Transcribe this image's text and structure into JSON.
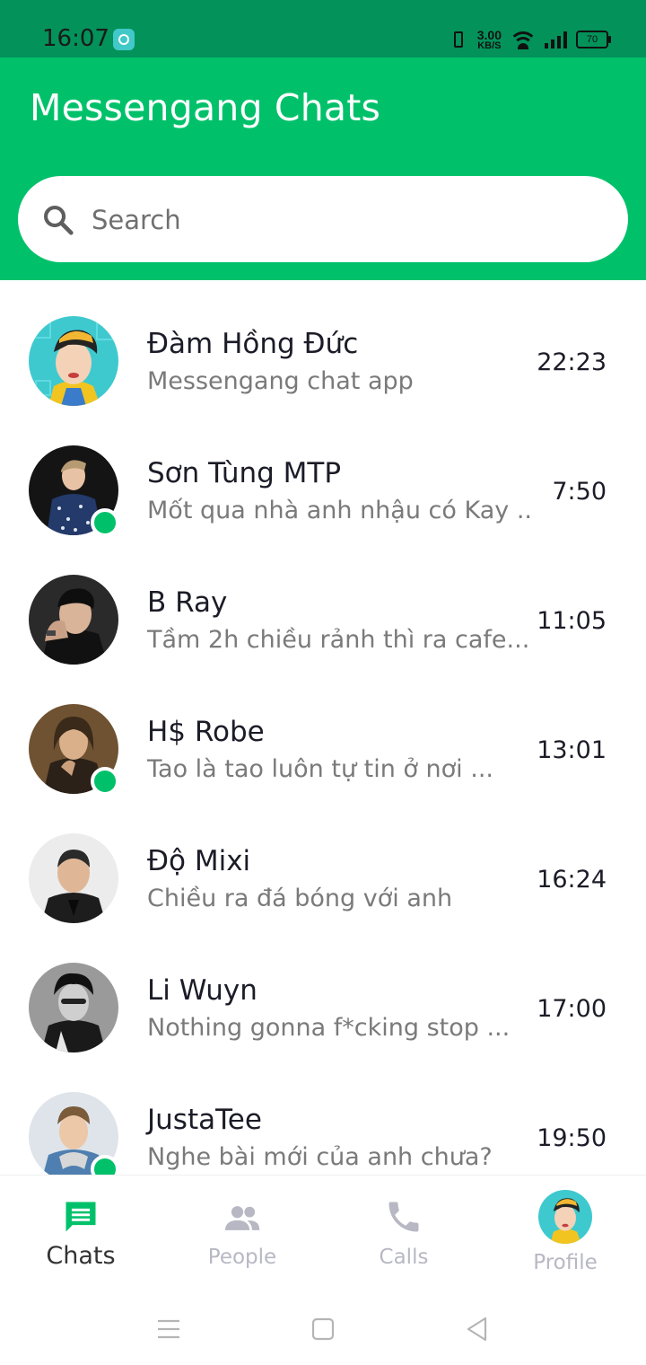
{
  "status_bar": {
    "time": "16:07",
    "net_speed": "3.00",
    "net_unit": "KB/S",
    "battery": "70"
  },
  "header": {
    "title": "Messengang Chats"
  },
  "search": {
    "placeholder": "Search"
  },
  "chats": [
    {
      "name": "Đàm Hồng Đức",
      "message": "Messengang chat app",
      "time": "22:23",
      "online": false,
      "avatar": "illustrated-avatar"
    },
    {
      "name": "Sơn Tùng MTP",
      "message": "Mốt qua nhà anh nhậu có Kay ...",
      "time": "7:50",
      "online": true,
      "avatar": "photo-avatar"
    },
    {
      "name": "B Ray",
      "message": "Tầm 2h chiều rảnh thì ra cafe...",
      "time": "11:05",
      "online": false,
      "avatar": "photo-avatar"
    },
    {
      "name": "H$ Robe",
      "message": "Tao là tao luôn tự tin ở nơi ...",
      "time": "13:01",
      "online": true,
      "avatar": "photo-avatar"
    },
    {
      "name": "Độ Mixi",
      "message": "Chiều ra đá bóng với anh",
      "time": "16:24",
      "online": false,
      "avatar": "photo-avatar"
    },
    {
      "name": "Li Wuyn",
      "message": "Nothing gonna f*cking stop ...",
      "time": "17:00",
      "online": false,
      "avatar": "photo-avatar"
    },
    {
      "name": "JustaTee",
      "message": "Nghe bài mới của anh chưa?",
      "time": "19:50",
      "online": true,
      "avatar": "photo-avatar"
    }
  ],
  "nav": {
    "chats": "Chats",
    "people": "People",
    "calls": "Calls",
    "profile": "Profile"
  },
  "colors": {
    "primary": "#00c16a",
    "status_bar": "#03925a",
    "inactive": "#b8b8c4"
  }
}
